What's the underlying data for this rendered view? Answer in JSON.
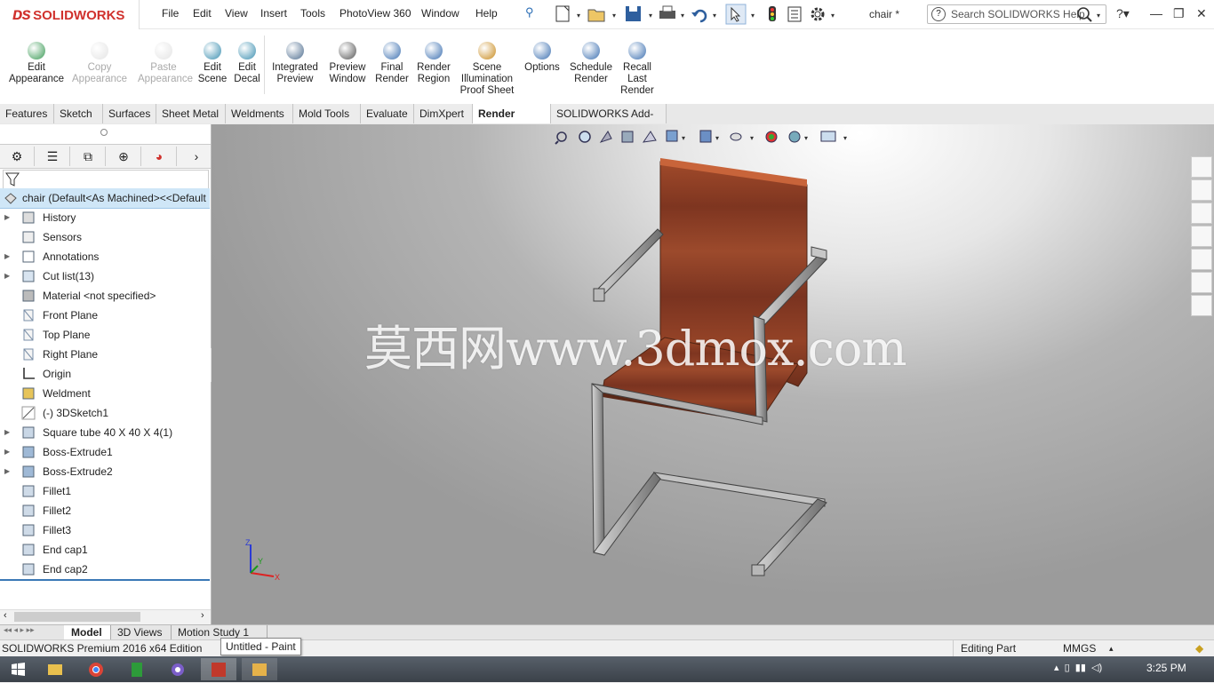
{
  "app": {
    "brand": "SOLIDWORKS",
    "document_title": "chair *"
  },
  "menu": [
    "File",
    "Edit",
    "View",
    "Insert",
    "Tools",
    "PhotoView 360",
    "Window",
    "Help"
  ],
  "search": {
    "placeholder": "Search SOLIDWORKS Help"
  },
  "command_manager": [
    {
      "label": [
        "Edit",
        "Appearance"
      ],
      "enabled": true,
      "icon": "edit-appearance-icon"
    },
    {
      "label": [
        "Copy",
        "Appearance"
      ],
      "enabled": false,
      "icon": "copy-appearance-icon"
    },
    {
      "label": [
        "Paste",
        "Appearance"
      ],
      "enabled": false,
      "icon": "paste-appearance-icon"
    },
    {
      "label": [
        "Edit",
        "Scene"
      ],
      "enabled": true,
      "icon": "edit-scene-icon"
    },
    {
      "label": [
        "Edit",
        "Decal"
      ],
      "enabled": true,
      "icon": "edit-decal-icon"
    },
    {
      "label": [
        "Integrated",
        "Preview"
      ],
      "enabled": true,
      "icon": "integrated-preview-icon"
    },
    {
      "label": [
        "Preview",
        "Window"
      ],
      "enabled": true,
      "icon": "preview-window-icon"
    },
    {
      "label": [
        "Final",
        "Render"
      ],
      "enabled": true,
      "icon": "final-render-icon"
    },
    {
      "label": [
        "Render",
        "Region"
      ],
      "enabled": true,
      "icon": "render-region-icon"
    },
    {
      "label": [
        "Scene",
        "Illumination",
        "Proof Sheet"
      ],
      "enabled": true,
      "icon": "scene-illumination-icon"
    },
    {
      "label": [
        "Options"
      ],
      "enabled": true,
      "icon": "options-icon"
    },
    {
      "label": [
        "Schedule",
        "Render"
      ],
      "enabled": true,
      "icon": "schedule-render-icon"
    },
    {
      "label": [
        "Recall",
        "Last",
        "Render"
      ],
      "enabled": true,
      "icon": "recall-render-icon"
    }
  ],
  "tabs": [
    "Features",
    "Sketch",
    "Surfaces",
    "Sheet Metal",
    "Weldments",
    "Mold Tools",
    "Evaluate",
    "DimXpert",
    "Render Tools",
    "SOLIDWORKS Add-Ins"
  ],
  "active_tab": "Render Tools",
  "feature_tree": {
    "root": "chair  (Default<As Machined><<Default",
    "items": [
      {
        "label": "History",
        "expandable": true,
        "icon": "history-icon"
      },
      {
        "label": "Sensors",
        "expandable": false,
        "icon": "sensors-icon"
      },
      {
        "label": "Annotations",
        "expandable": true,
        "icon": "annotations-icon"
      },
      {
        "label": "Cut list(13)",
        "expandable": true,
        "icon": "cut-list-icon"
      },
      {
        "label": "Material <not specified>",
        "expandable": false,
        "icon": "material-icon"
      },
      {
        "label": "Front Plane",
        "expandable": false,
        "icon": "plane-icon"
      },
      {
        "label": "Top Plane",
        "expandable": false,
        "icon": "plane-icon"
      },
      {
        "label": "Right Plane",
        "expandable": false,
        "icon": "plane-icon"
      },
      {
        "label": "Origin",
        "expandable": false,
        "icon": "origin-icon"
      },
      {
        "label": "Weldment",
        "expandable": false,
        "icon": "weldment-icon"
      },
      {
        "label": "(-) 3DSketch1",
        "expandable": false,
        "icon": "sketch-icon"
      },
      {
        "label": "Square tube 40 X 40 X 4(1)",
        "expandable": true,
        "icon": "structural-member-icon"
      },
      {
        "label": "Boss-Extrude1",
        "expandable": true,
        "icon": "extrude-icon"
      },
      {
        "label": "Boss-Extrude2",
        "expandable": true,
        "icon": "extrude-icon"
      },
      {
        "label": "Fillet1",
        "expandable": false,
        "icon": "fillet-icon"
      },
      {
        "label": "Fillet2",
        "expandable": false,
        "icon": "fillet-icon"
      },
      {
        "label": "Fillet3",
        "expandable": false,
        "icon": "fillet-icon"
      },
      {
        "label": "End cap1",
        "expandable": false,
        "icon": "end-cap-icon"
      },
      {
        "label": "End cap2",
        "expandable": false,
        "icon": "end-cap-icon"
      }
    ]
  },
  "viewport": {
    "watermark": "莫西网www.3dmox.com",
    "triad": {
      "x": "X",
      "y": "Y",
      "z": "Z"
    }
  },
  "bottom_tabs": [
    "Model",
    "3D Views",
    "Motion Study 1"
  ],
  "status": {
    "edition": "SOLIDWORKS Premium 2016 x64 Edition",
    "mode": "Editing Part",
    "units": "MMGS"
  },
  "tooltip": "Untitled - Paint",
  "taskbar": {
    "time": "3:25 PM"
  },
  "colors": {
    "accent": "#d0312d",
    "selection": "#cfe6f7",
    "wood": "#8a3b22",
    "steel": "#a8a8a8"
  }
}
